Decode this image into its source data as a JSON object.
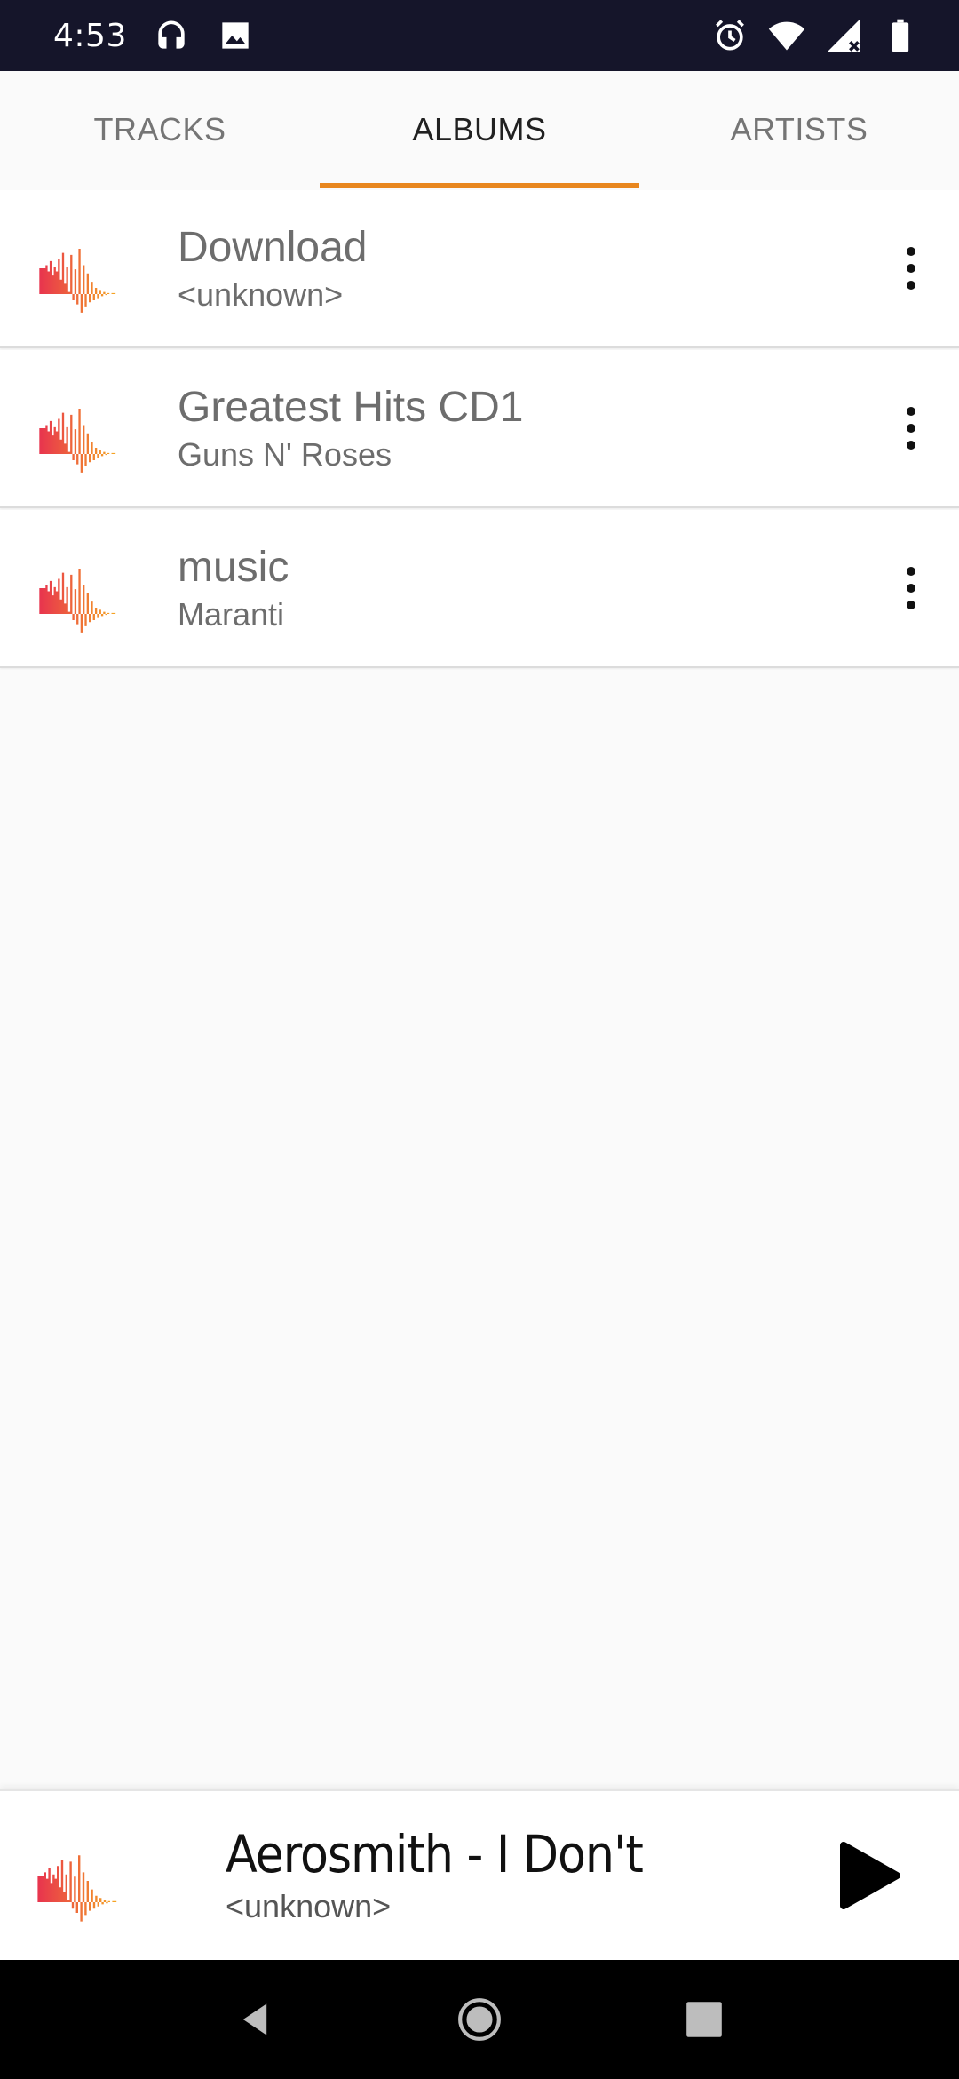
{
  "status_bar": {
    "time": "4:53",
    "left_icons": [
      "headset-icon",
      "image-icon"
    ],
    "right_icons": [
      "alarm-icon",
      "wifi-icon",
      "signal-icon",
      "battery-icon"
    ]
  },
  "tabs": [
    {
      "label": "TRACKS",
      "active": false
    },
    {
      "label": "ALBUMS",
      "active": true
    },
    {
      "label": "ARTISTS",
      "active": false
    }
  ],
  "albums": [
    {
      "title": "Download",
      "artist": "<unknown>"
    },
    {
      "title": "Greatest Hits CD1",
      "artist": "Guns N' Roses"
    },
    {
      "title": "music",
      "artist": "Maranti"
    }
  ],
  "now_playing": {
    "title": "Aerosmith - I Don't",
    "artist": "<unknown>"
  },
  "colors": {
    "accent": "#e8861e",
    "status_bar": "#15152a",
    "waveform_start": "#e8344e",
    "waveform_end": "#f5a623"
  },
  "nav": {
    "icons": [
      "back-icon",
      "home-icon",
      "recents-icon"
    ]
  }
}
